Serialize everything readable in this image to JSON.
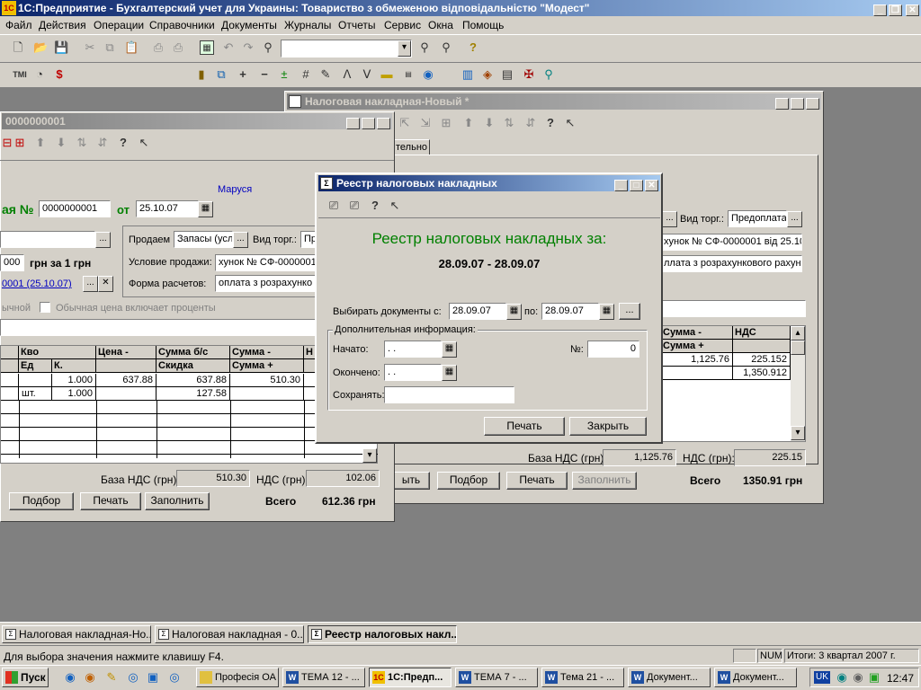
{
  "app": {
    "title": "1С:Предприятие - Бухгалтерский учет для Украины: Товариство з обмеженою відповідальністю \"Модест\"",
    "icon_text": "1С"
  },
  "menu": [
    "Файл",
    "Действия",
    "Операции",
    "Справочники",
    "Документы",
    "Журналы",
    "Отчеты",
    "Сервис",
    "Окна",
    "Помощь"
  ],
  "win_invoice": {
    "title": "Налоговая накладная-Новый *",
    "tab_label": "тельно",
    "contract_label": "Вид торг.:",
    "contract_value": "Предоплата",
    "invoice_ref": "хунок № СФ-0000001 від 25.10.",
    "payment_value": "ллата з розрахункового рахунку",
    "cols": [
      "Сумма -",
      "НДС",
      "Сумма +"
    ],
    "rows": [
      [
        "1,125.76",
        "225.152"
      ],
      [
        "",
        "1,350.912"
      ]
    ],
    "vat_base_label": "База НДС (грн):",
    "vat_base_value": "1,125.76",
    "vat_label": "НДС (грн):",
    "vat_value": "225.15",
    "btn_partial": "ыть",
    "btn_select": "Подбор",
    "btn_print": "Печать",
    "btn_fill": "Заполнить",
    "total_label": "Всего",
    "total_value": "1350.91 грн"
  },
  "win_doc": {
    "title": "0000000001",
    "user": "Маруся",
    "num_label": "ая №",
    "num_value": "0000000001",
    "from_label": "от",
    "date_value": "25.10.07",
    "sell_label": "Продаем",
    "sell_value": "Запасы (усл",
    "trade_label": "Вид торг.:",
    "trade_value": "Пр",
    "rate_value": "000",
    "rate_text": "грн за 1 грн",
    "cond_label": "Условие продажи:",
    "cond_value": "хунок № СФ-0000001",
    "link_text": "0001 (25.10.07)",
    "calc_label": "Форма расчетов:",
    "calc_value": "оплата з розрахунко",
    "price_type": "ычной",
    "price_check": "Обычная цена включает проценты",
    "cols_top": [
      "Кво",
      "Цена -",
      "Сумма б/с",
      "Сумма -",
      "Н"
    ],
    "cols_bottom": [
      "Ед",
      "К.",
      "Скидка",
      "Сумма +"
    ],
    "rows": [
      {
        "unit": "",
        "k": "1.000",
        "price": "637.88",
        "sum_bs": "637.88",
        "sum": "510.30"
      },
      {
        "unit": "шт.",
        "k": "1.000",
        "price": "",
        "sum_bs": "127.58",
        "sum": ""
      }
    ],
    "vat_base_label": "База НДС (грн):",
    "vat_base_value": "510.30",
    "vat_label": "НДС (грн):",
    "vat_value": "102.06",
    "btn_select": "Подбор",
    "btn_print": "Печать",
    "btn_fill": "Заполнить",
    "total_label": "Всего",
    "total_value": "612.36 грн"
  },
  "dialog": {
    "title": "Реестр налоговых накладных",
    "heading": "Реестр налоговых накладных за:",
    "period": "28.09.07 - 28.09.07",
    "select_label": "Выбирать документы с:",
    "date_from": "28.09.07",
    "to_label": "по:",
    "date_to": "28.09.07",
    "ellipsis": "...",
    "group_label": "Дополнительная информация:",
    "start_label": "Начато:",
    "start_value": ". .",
    "number_label": "№:",
    "number_value": "0",
    "end_label": "Окончено:",
    "end_value": ". .",
    "keep_label": "Сохранять:",
    "keep_value": "",
    "btn_print": "Печать",
    "btn_close": "Закрыть"
  },
  "mdi_tasks": [
    "Налоговая накладная-Но...",
    "Налоговая накладная - 0...",
    "Реестр налоговых накл..."
  ],
  "status": {
    "hint": "Для выбора значения нажмите клавишу F4.",
    "num": "NUM",
    "totals": "Итоги: 3 квартал 2007 г."
  },
  "taskbar": {
    "start": "Пуск",
    "items": [
      "Професія ОА",
      "ТЕМА 12 - ...",
      "1С:Предп...",
      "ТЕМА 7 - ...",
      "Тема 21 - ...",
      "Документ...",
      "Документ..."
    ],
    "lang": "UK",
    "clock": "12:47"
  }
}
